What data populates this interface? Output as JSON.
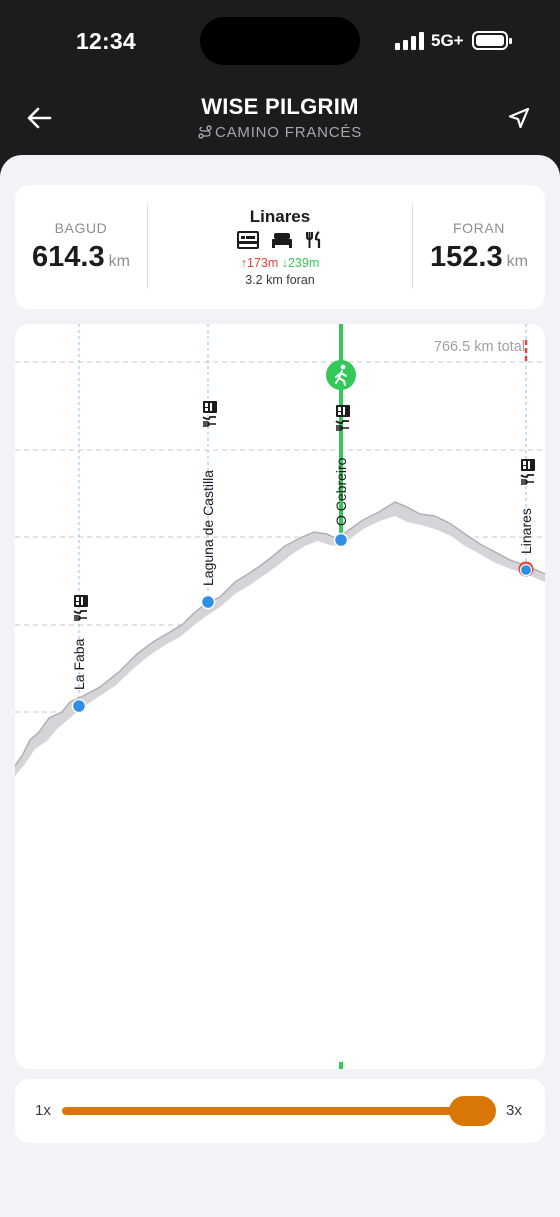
{
  "status_bar": {
    "time": "12:34",
    "network": "5G+"
  },
  "header": {
    "title": "WISE PILGRIM",
    "subtitle": "CAMINO FRANCÉS"
  },
  "summary": {
    "behind_label": "BAGUD",
    "behind_value": "614.3",
    "behind_unit": "km",
    "location_name": "Linares",
    "amenities": [
      "hostel-icon",
      "bed-icon",
      "restaurant-icon"
    ],
    "ascent": "↑173m",
    "descent": "↓239m",
    "distance_ahead": "3.2 km foran",
    "ahead_label": "FORAN",
    "ahead_value": "152.3",
    "ahead_unit": "km"
  },
  "chart": {
    "total_label": "766.5 km total",
    "current_position_icon": "walking-person-icon",
    "colors": {
      "route_line": "#34c759",
      "marker": "#2f8fe6",
      "destination": "#e0453a"
    },
    "places": [
      {
        "name": "La Faba",
        "amenities": [
          "hostel-icon",
          "restaurant-icon"
        ]
      },
      {
        "name": "Laguna de Castilla",
        "amenities": [
          "hostel-icon",
          "restaurant-icon"
        ]
      },
      {
        "name": "O Cebreiro",
        "amenities": [
          "hostel-icon",
          "restaurant-icon"
        ],
        "current": true
      },
      {
        "name": "Linares",
        "amenities": [
          "hostel-icon",
          "restaurant-icon"
        ],
        "destination": true
      }
    ]
  },
  "zoom": {
    "min_label": "1x",
    "max_label": "3x",
    "value_fraction": 1.0,
    "accent": "#d97706"
  }
}
